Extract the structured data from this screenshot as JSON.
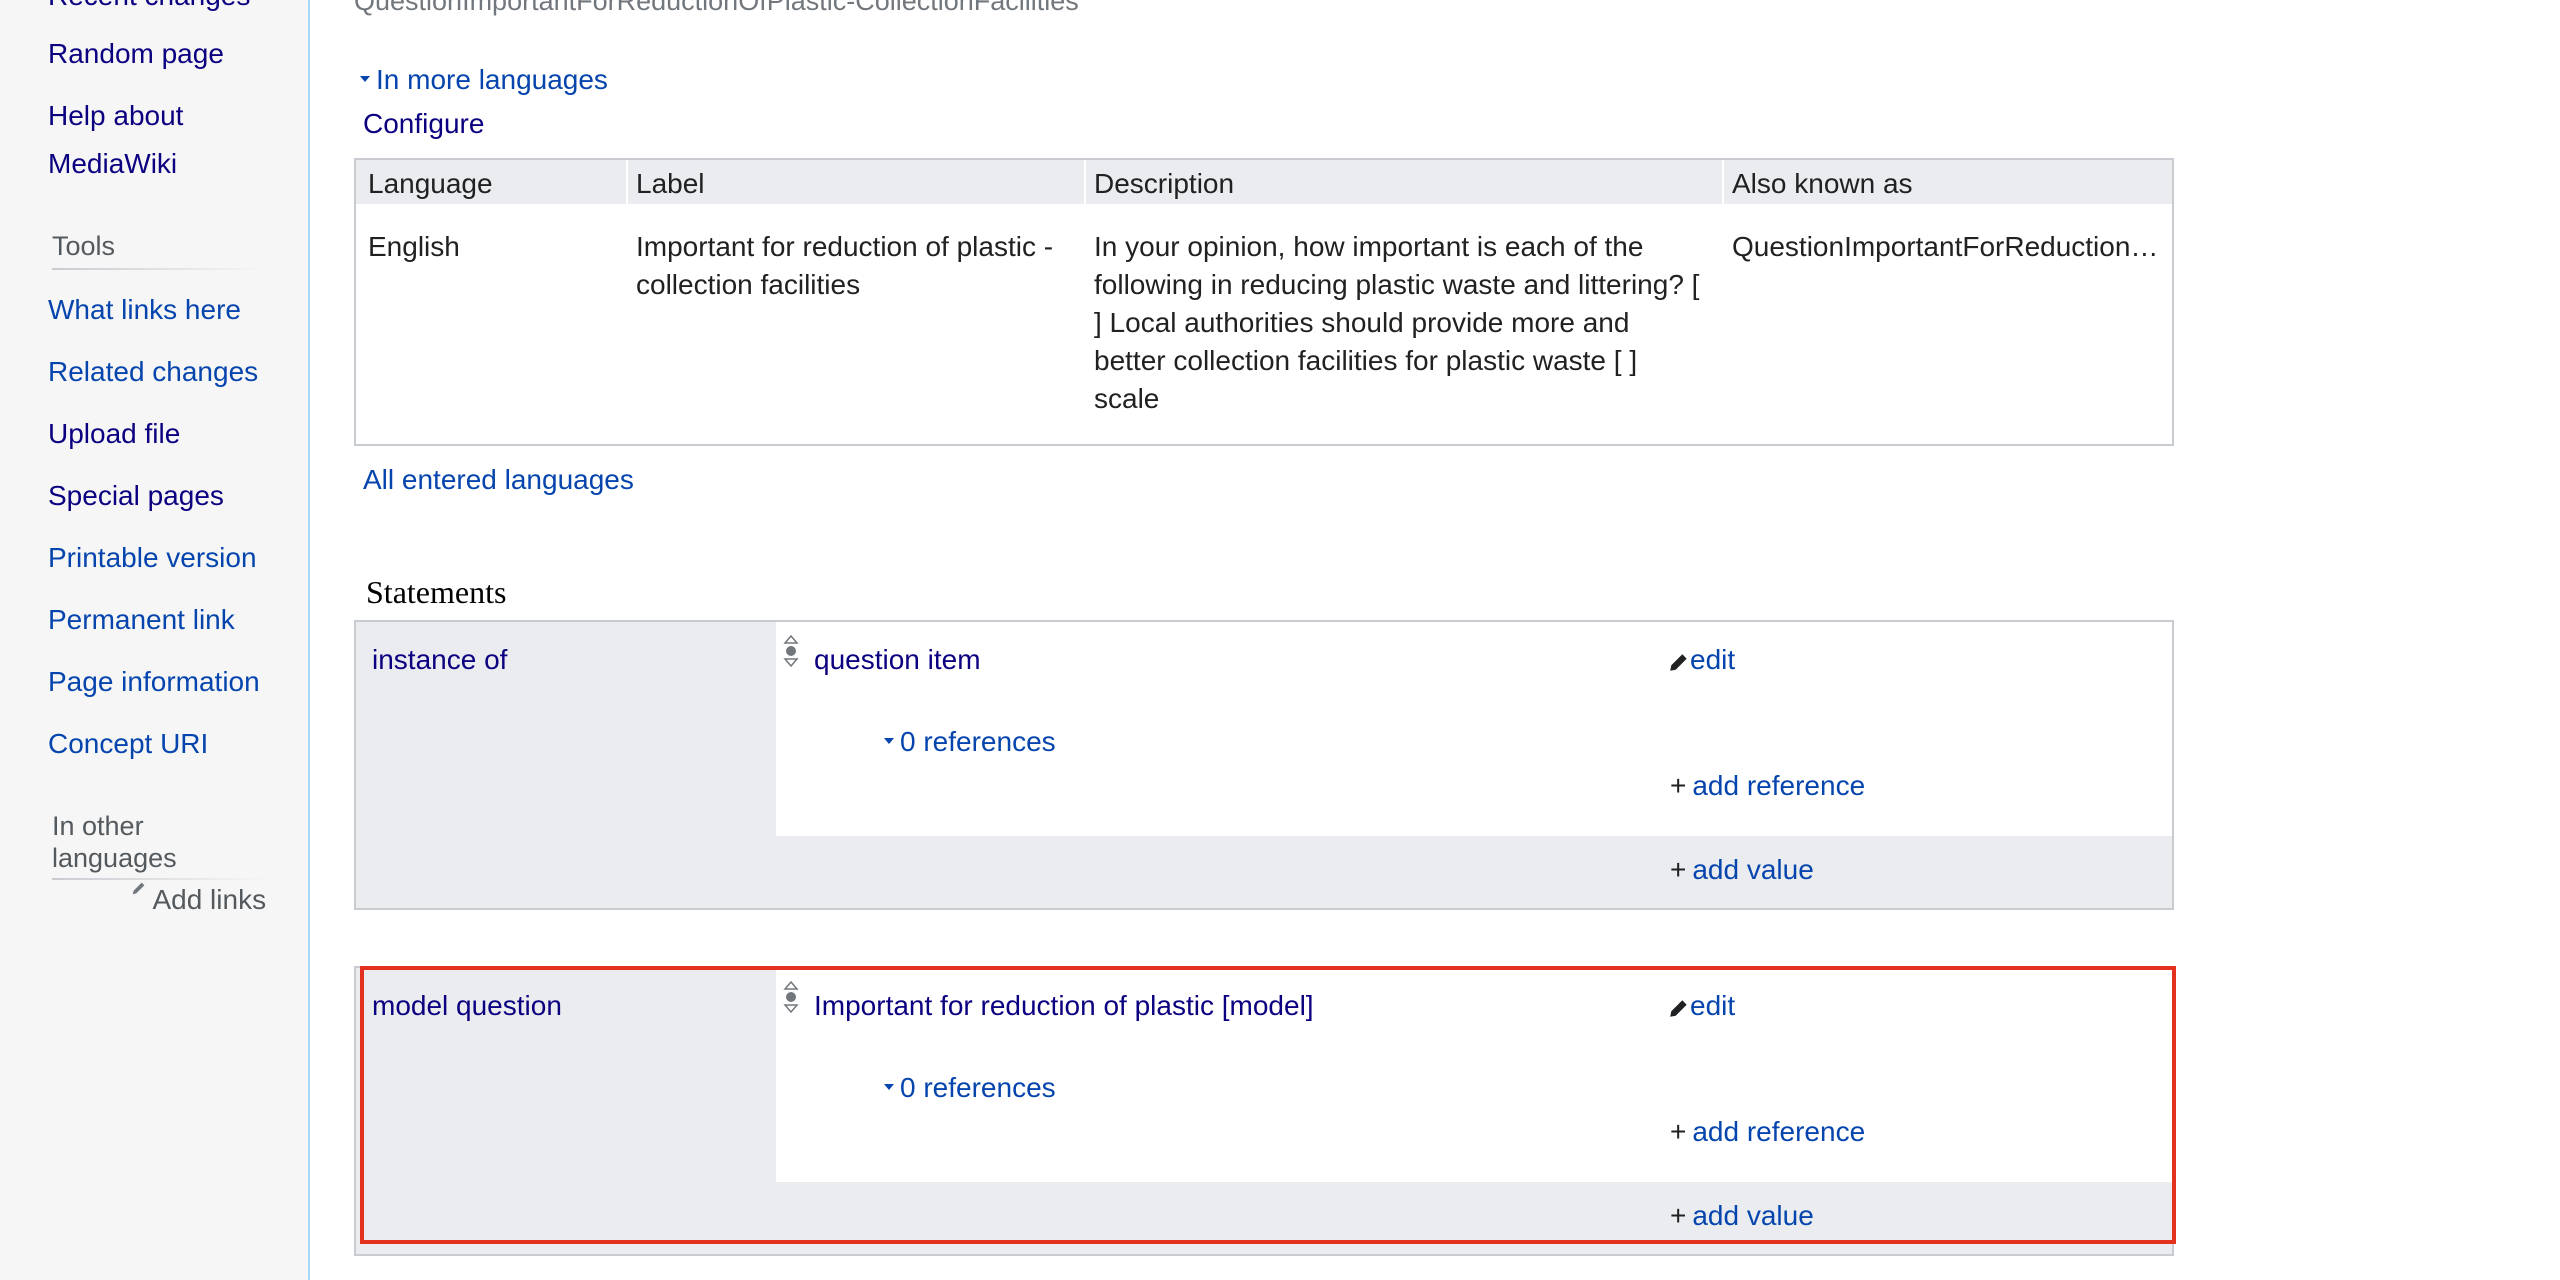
{
  "sidebar": {
    "cut_item": "Recent changes",
    "items": [
      "Random page",
      "Help about",
      "MediaWiki"
    ],
    "tools_heading": "Tools",
    "tools": [
      "What links here",
      "Related changes",
      "Upload file",
      "Special pages",
      "Printable version",
      "Permanent link",
      "Page information",
      "Concept URI"
    ],
    "other_lang_heading_1": "In other",
    "other_lang_heading_2": "languages",
    "add_links": "Add links"
  },
  "main": {
    "top_subtitle": "QuestionImportantForReductionOfPlastic-CollectionFacilities",
    "in_more_languages": "In more languages",
    "configure": "Configure",
    "table": {
      "headers": [
        "Language",
        "Label",
        "Description",
        "Also known as"
      ],
      "row": {
        "language": "English",
        "label_1": "Important for reduction of plastic -",
        "label_2": "collection facilities",
        "desc_1": "In your opinion, how important is each of the",
        "desc_2": "following in reducing plastic waste and littering? [",
        "desc_3": "] Local authorities should provide more and",
        "desc_4": "better collection facilities for plastic waste [ ]",
        "desc_5": "scale",
        "aliases": "QuestionImportantForReduction…"
      }
    },
    "all_entered_languages": "All entered languages",
    "statements_heading": "Statements",
    "statements": [
      {
        "property": "instance of",
        "value": "question item",
        "edit": "edit",
        "references": "0 references",
        "add_reference": "add reference",
        "add_value": "add value"
      },
      {
        "property": "model question",
        "value": "Important for reduction of plastic [model]",
        "edit": "edit",
        "references": "0 references",
        "add_reference": "add reference",
        "add_value": "add value"
      }
    ],
    "plus_sign": "+"
  },
  "colors": {
    "link": "#0645ad",
    "visited_link": "#0b0080",
    "highlight_border": "#e3311d",
    "panel_gray": "#eaecf0"
  }
}
